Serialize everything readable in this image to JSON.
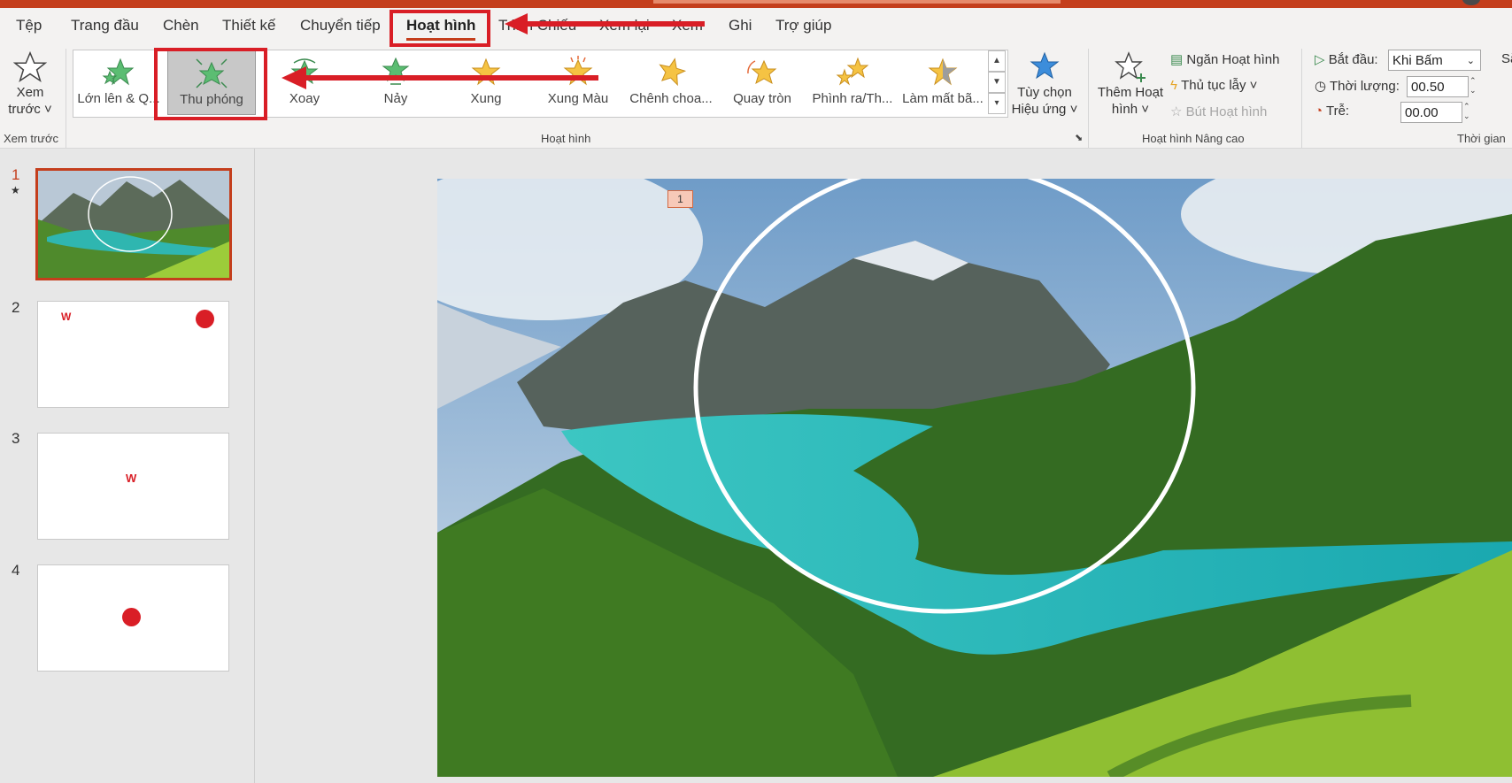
{
  "tabs": [
    {
      "label": "Tệp"
    },
    {
      "label": "Trang đầu"
    },
    {
      "label": "Chèn"
    },
    {
      "label": "Thiết kế"
    },
    {
      "label": "Chuyển tiếp"
    },
    {
      "label": "Hoạt hình",
      "active": true
    },
    {
      "label": "Trình Chiếu"
    },
    {
      "label": "Xem lại"
    },
    {
      "label": "Xem"
    },
    {
      "label": "Ghi"
    },
    {
      "label": "Trợ giúp"
    }
  ],
  "preview": {
    "label_line1": "Xem",
    "label_line2": "trước",
    "group": "Xem trước"
  },
  "effects": [
    {
      "label": "Lớn lên & Q...",
      "icon": "grow-turn-star-icon"
    },
    {
      "label": "Thu phóng",
      "icon": "zoom-star-icon",
      "selected": true
    },
    {
      "label": "Xoay",
      "icon": "swivel-star-icon"
    },
    {
      "label": "Nảy",
      "icon": "bounce-star-icon"
    },
    {
      "label": "Xung",
      "icon": "pulse-star-icon"
    },
    {
      "label": "Xung Màu",
      "icon": "color-pulse-star-icon"
    },
    {
      "label": "Chênh choa...",
      "icon": "teeter-star-icon"
    },
    {
      "label": "Quay tròn",
      "icon": "spin-star-icon"
    },
    {
      "label": "Phình ra/Th...",
      "icon": "grow-shrink-star-icon"
    },
    {
      "label": "Làm mất bã...",
      "icon": "desaturate-star-icon"
    }
  ],
  "effect_options": {
    "line1": "Tùy chọn",
    "line2": "Hiệu ứng"
  },
  "animation_group": "Hoạt hình",
  "advanced": {
    "add_line1": "Thêm Hoạt",
    "add_line2": "hình",
    "pane": "Ngăn Hoạt hình",
    "trigger": "Thủ tục lẫy",
    "painter": "Bút Hoạt hình",
    "group": "Hoạt hình Nâng cao"
  },
  "timing": {
    "start_label": "Bắt đầu:",
    "start_value": "Khi Bấm",
    "duration_label": "Thời lượng:",
    "duration_value": "00.50",
    "delay_label": "Trễ:",
    "delay_value": "00.00",
    "group": "Thời gian",
    "cut_label": "Sắ"
  },
  "slides": [
    {
      "num": "1",
      "star": "★"
    },
    {
      "num": "2"
    },
    {
      "num": "3"
    },
    {
      "num": "4"
    }
  ],
  "slide_badge": "1",
  "colors": {
    "accent": "#c43e1c",
    "annotation": "#d91e26",
    "star_green": "#5bbd72",
    "star_gold": "#f5c343",
    "star_blue": "#3c8ddb"
  }
}
